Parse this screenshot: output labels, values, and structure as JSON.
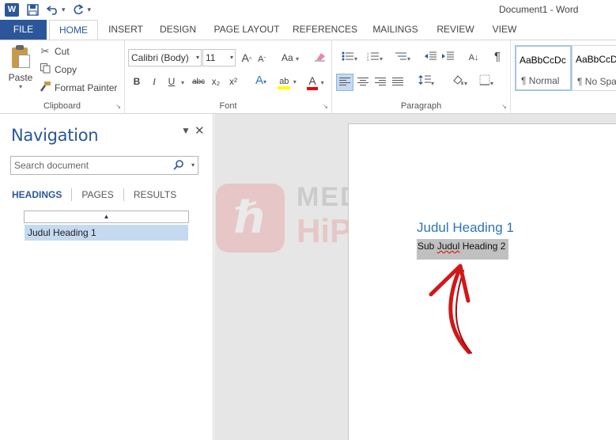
{
  "window": {
    "title": "Document1 - Word",
    "app_logo": "W"
  },
  "qat": {
    "icons": [
      "word-logo-icon",
      "save-icon",
      "undo-icon",
      "redo-icon",
      "customize-icon"
    ]
  },
  "tabs": [
    {
      "label": "FILE"
    },
    {
      "label": "HOME"
    },
    {
      "label": "INSERT"
    },
    {
      "label": "DESIGN"
    },
    {
      "label": "PAGE LAYOUT"
    },
    {
      "label": "REFERENCES"
    },
    {
      "label": "MAILINGS"
    },
    {
      "label": "REVIEW"
    },
    {
      "label": "VIEW"
    }
  ],
  "ribbon": {
    "clipboard": {
      "label": "Clipboard",
      "paste": "Paste",
      "cut": "Cut",
      "copy": "Copy",
      "format_painter": "Format Painter"
    },
    "font": {
      "label": "Font",
      "font_name": "Calibri (Body)",
      "font_size": "11",
      "bold": "B",
      "italic": "I",
      "underline": "U",
      "strike": "abc",
      "subscript": "x₂",
      "superscript": "x²",
      "grow": "A",
      "shrink": "A",
      "change_case": "Aa",
      "text_effects": "A",
      "highlight": "ab",
      "font_color": "A"
    },
    "paragraph": {
      "label": "Paragraph",
      "sort": "A↓",
      "pilcrow": "¶"
    },
    "styles": {
      "items": [
        {
          "preview": "AaBbCcDc",
          "name": "¶ Normal"
        },
        {
          "preview": "AaBbCcDc",
          "name": "¶ No Spac"
        }
      ]
    }
  },
  "navigation": {
    "title": "Navigation",
    "search_placeholder": "Search document",
    "tabs": [
      "HEADINGS",
      "PAGES",
      "RESULTS"
    ],
    "collapse_glyph": "▲",
    "headings": [
      "Judul Heading 1"
    ]
  },
  "document": {
    "heading1": "Judul Heading 1",
    "heading2_prefix": "Sub ",
    "heading2_word": "Judul",
    "heading2_suffix": " Heading 2"
  },
  "watermark": {
    "line1": "MEDIA",
    "line2": "HiPoin"
  },
  "colors": {
    "accent": "#2b579a",
    "heading": "#2e74b5",
    "arrow": "#d01818"
  }
}
